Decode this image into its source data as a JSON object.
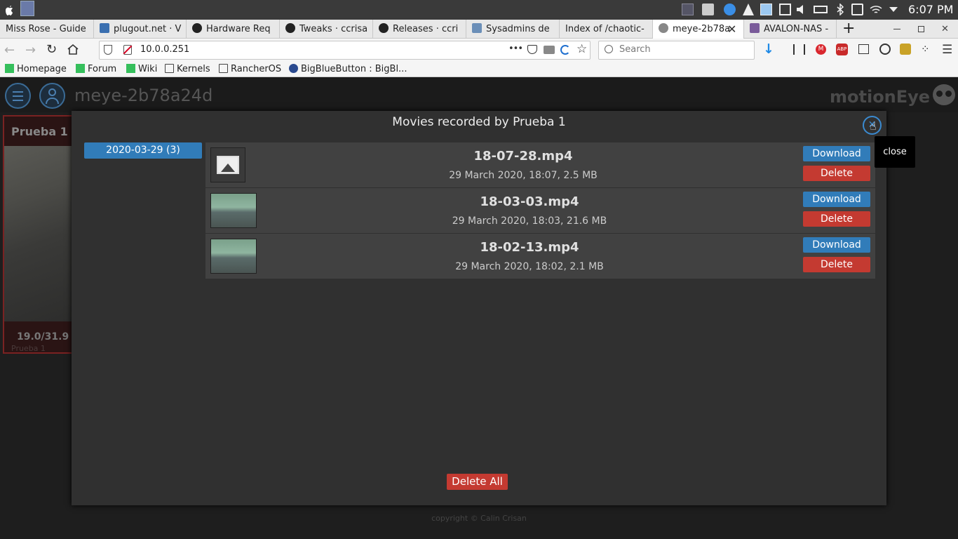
{
  "system": {
    "clock": "6:07 PM"
  },
  "tabs": [
    {
      "label": "Miss Rose - Guide"
    },
    {
      "label": "plugout.net · V"
    },
    {
      "label": "Hardware Req"
    },
    {
      "label": "Tweaks · ccrisa"
    },
    {
      "label": "Releases · ccri"
    },
    {
      "label": "Sysadmins de"
    },
    {
      "label": "Index of /chaotic-"
    },
    {
      "label": "meye-2b78a"
    },
    {
      "label": "AVALON-NAS -"
    }
  ],
  "navbar": {
    "url": "10.0.0.251",
    "search_placeholder": "Search",
    "more": "•••"
  },
  "bookmarks": [
    {
      "label": "Homepage"
    },
    {
      "label": "Forum"
    },
    {
      "label": "Wiki"
    },
    {
      "label": "Kernels"
    },
    {
      "label": "RancherOS"
    },
    {
      "label": "BigBlueButton : BigBl..."
    }
  ],
  "app": {
    "hostname": "meye-2b78a24d",
    "brand": "motionEye",
    "camera_name": "Prueba 1",
    "camera_fps": "19.0/31.9",
    "camera_overlay": "Prueba 1",
    "footer": "copyright © Calin Crisan"
  },
  "dialog": {
    "title": "Movies recorded by Prueba 1",
    "close_tooltip": "close",
    "date_group": "2020-03-29 (3)",
    "download_label": "Download",
    "delete_label": "Delete",
    "delete_all_label": "Delete All",
    "movies": [
      {
        "name": "18-07-28.mp4",
        "meta": "29 March 2020, 18:07, 2.5 MB"
      },
      {
        "name": "18-03-03.mp4",
        "meta": "29 March 2020, 18:03, 21.6 MB"
      },
      {
        "name": "18-02-13.mp4",
        "meta": "29 March 2020, 18:02, 2.1 MB"
      }
    ]
  },
  "colors": {
    "accent": "#317cb9",
    "danger": "#c43a31",
    "dialog_bg": "#303030",
    "row_bg": "#414141"
  }
}
